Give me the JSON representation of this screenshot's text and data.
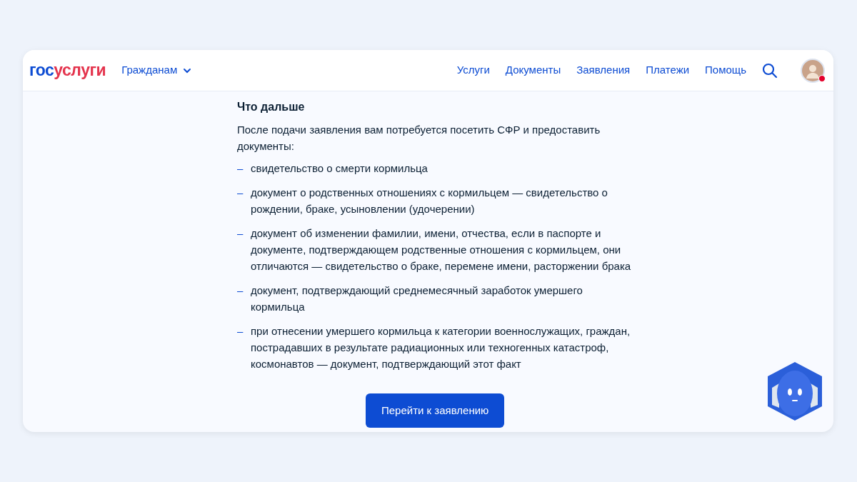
{
  "header": {
    "logo": {
      "part_1": "гос",
      "part_2": "услуги"
    },
    "audience_menu": {
      "label": "Гражданам",
      "expanded": false
    },
    "nav": [
      "Услуги",
      "Документы",
      "Заявления",
      "Платежи",
      "Помощь"
    ],
    "avatar": {
      "has_notification": true
    }
  },
  "content": {
    "heading": "Что дальше",
    "intro": "После подачи заявления вам потребуется посетить СФР и предоставить документы:",
    "list_marker": "–",
    "items": [
      "свидетельство о смерти кормильца",
      "документ о родственных отношениях с кормильцем — свидетельство о рождении, браке, усыновлении (удочерении)",
      "документ об изменении фамилии, имени, отчества, если в паспорте и документе, подтверждающем родственные отношения с кормильцем, они отличаются — свидетельство о браке, перемене имени, расторжении брака",
      "документ, подтверждающий среднемесячный заработок умершего кормильца",
      "при отнесении умершего кормильца к категории военнослужащих, граждан, пострадавших в результате радиационных или техногенных катастроф, космонавтов — документ, подтверждающий этот факт"
    ],
    "button": "Перейти к заявлению"
  }
}
